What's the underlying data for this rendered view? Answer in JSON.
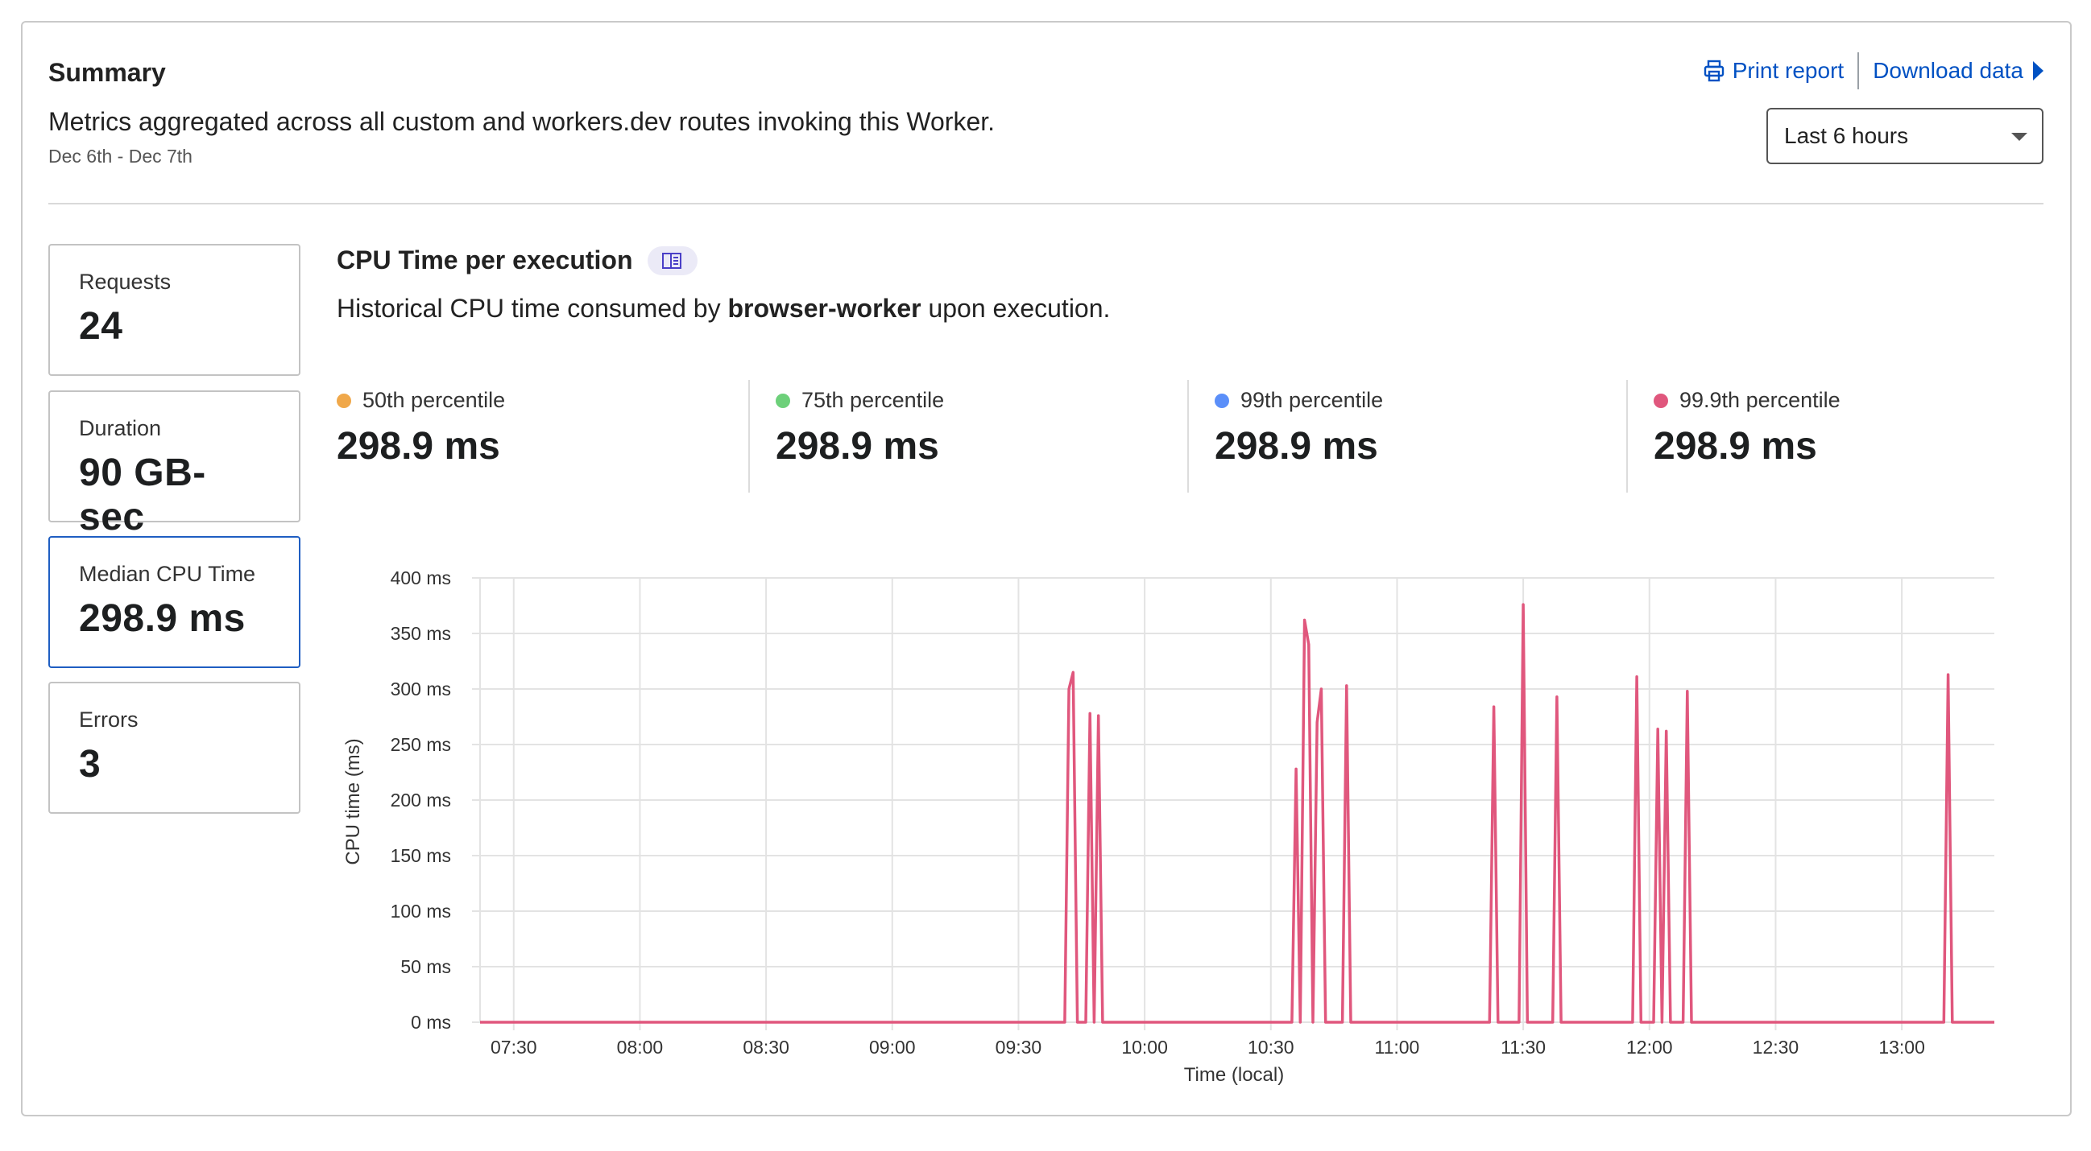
{
  "summary": {
    "title": "Summary",
    "description": "Metrics aggregated across all custom and workers.dev routes invoking this Worker.",
    "date_range": "Dec 6th - Dec 7th"
  },
  "actions": {
    "print_label": "Print report",
    "download_label": "Download data",
    "link_color": "#0051c3"
  },
  "time_select": {
    "value": "Last 6 hours"
  },
  "stats": [
    {
      "label": "Requests",
      "value": "24"
    },
    {
      "label": "Duration",
      "value": "90 GB-sec"
    },
    {
      "label": "Median CPU Time",
      "value": "298.9 ms",
      "selected": true
    },
    {
      "label": "Errors",
      "value": "3"
    }
  ],
  "chart_header": {
    "title": "CPU Time per execution",
    "desc_before": "Historical CPU time consumed by ",
    "desc_worker": "browser-worker",
    "desc_after": " upon execution."
  },
  "percentiles": [
    {
      "label": "50th percentile",
      "value": "298.9 ms",
      "color": "#f0a84a"
    },
    {
      "label": "75th percentile",
      "value": "298.9 ms",
      "color": "#6dd07a"
    },
    {
      "label": "99th percentile",
      "value": "298.9 ms",
      "color": "#5b8ff9"
    },
    {
      "label": "99.9th percentile",
      "value": "298.9 ms",
      "color": "#e0577d"
    }
  ],
  "chart_data": {
    "type": "line",
    "xlabel": "Time (local)",
    "ylabel": "CPU time (ms)",
    "ylim": [
      0,
      400
    ],
    "y_ticks": [
      0,
      50,
      100,
      150,
      200,
      250,
      300,
      350,
      400
    ],
    "y_tick_labels": [
      "0 ms",
      "50 ms",
      "100 ms",
      "150 ms",
      "200 ms",
      "250 ms",
      "300 ms",
      "350 ms",
      "400 ms"
    ],
    "x_range": [
      "07:22",
      "13:22"
    ],
    "x_ticks": [
      "07:30",
      "08:00",
      "08:30",
      "09:00",
      "09:30",
      "10:00",
      "10:30",
      "11:00",
      "11:30",
      "12:00",
      "12:30",
      "13:00"
    ],
    "grid": true,
    "series": [
      {
        "color": "#e0577d",
        "points": [
          [
            "07:22",
            0
          ],
          [
            "09:41",
            0
          ],
          [
            "09:42",
            300
          ],
          [
            "09:43",
            315
          ],
          [
            "09:44",
            0
          ],
          [
            "09:46",
            0
          ],
          [
            "09:47",
            278
          ],
          [
            "09:48",
            0
          ],
          [
            "09:49",
            276
          ],
          [
            "09:50",
            0
          ],
          [
            "10:35",
            0
          ],
          [
            "10:36",
            228
          ],
          [
            "10:37",
            0
          ],
          [
            "10:38",
            362
          ],
          [
            "10:39",
            340
          ],
          [
            "10:40",
            0
          ],
          [
            "10:41",
            270
          ],
          [
            "10:42",
            300
          ],
          [
            "10:43",
            0
          ],
          [
            "10:47",
            0
          ],
          [
            "10:48",
            303
          ],
          [
            "10:49",
            0
          ],
          [
            "11:22",
            0
          ],
          [
            "11:23",
            284
          ],
          [
            "11:24",
            0
          ],
          [
            "11:29",
            0
          ],
          [
            "11:30",
            376
          ],
          [
            "11:31",
            0
          ],
          [
            "11:37",
            0
          ],
          [
            "11:38",
            293
          ],
          [
            "11:39",
            0
          ],
          [
            "11:56",
            0
          ],
          [
            "11:57",
            311
          ],
          [
            "11:58",
            0
          ],
          [
            "12:01",
            0
          ],
          [
            "12:02",
            264
          ],
          [
            "12:03",
            0
          ],
          [
            "12:04",
            262
          ],
          [
            "12:05",
            0
          ],
          [
            "12:08",
            0
          ],
          [
            "12:09",
            298
          ],
          [
            "12:10",
            0
          ],
          [
            "13:10",
            0
          ],
          [
            "13:11",
            313
          ],
          [
            "13:12",
            0
          ],
          [
            "13:22",
            0
          ]
        ]
      }
    ]
  }
}
